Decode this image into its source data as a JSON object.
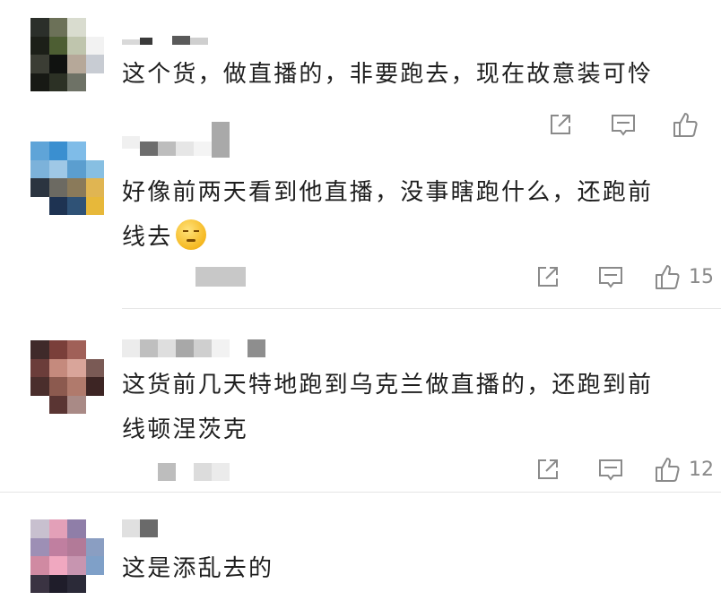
{
  "comments": [
    {
      "text_lines": [
        "这个货，做直播的，非要跑去，现在故意装可怜"
      ],
      "likes": ""
    },
    {
      "text_lines": [
        "好像前两天看到他直播，没事瞎跑什么，还跑前",
        "线去"
      ],
      "likes": "15"
    },
    {
      "text_lines": [
        "这货前几天特地跑到乌克兰做直播的，还跑到前",
        "线顿涅茨克"
      ],
      "likes": "12"
    },
    {
      "text_lines": [
        "这是添乱去的"
      ],
      "likes": ""
    }
  ]
}
